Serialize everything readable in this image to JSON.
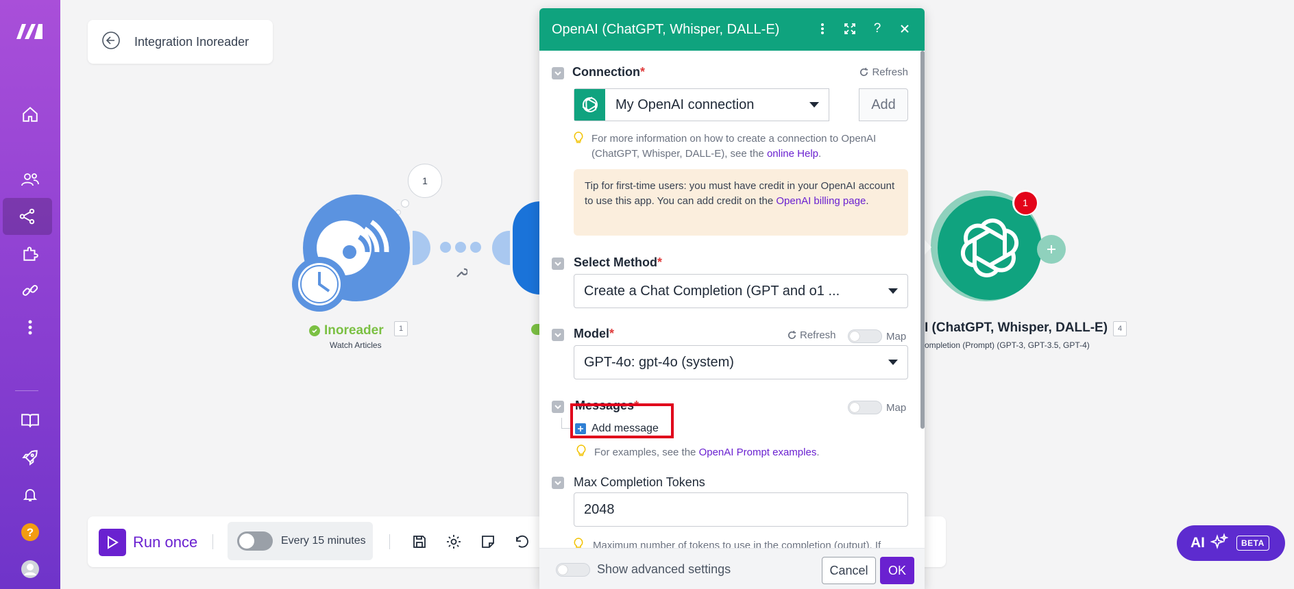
{
  "breadcrumb": {
    "title": "Integration Inoreader"
  },
  "canvas": {
    "module1": {
      "title": "Inoreader",
      "subtitle": "Watch Articles",
      "index": "1",
      "bubble": "1"
    },
    "module4": {
      "title": "I (ChatGPT, Whisper, DALL-E)",
      "subtitle": "ompletion (Prompt) (GPT-3, GPT-3.5, GPT-4)",
      "index": "4",
      "badge": "1"
    }
  },
  "toolbar": {
    "run_label": "Run once",
    "schedule_label": "Every 15 minutes"
  },
  "ai_button": {
    "label": "AI",
    "badge": "BETA"
  },
  "modal": {
    "title": "OpenAI (ChatGPT, Whisper, DALL-E)",
    "connection": {
      "label": "Connection",
      "required": "*",
      "refresh": "Refresh",
      "value": "My OpenAI connection",
      "add": "Add",
      "hint_prefix": "For more information on how to create a connection to OpenAI (ChatGPT, Whisper, DALL-E), see the ",
      "hint_link": "online Help",
      "hint_suffix": "."
    },
    "tip": {
      "prefix": "Tip for first-time users: you must have credit in your OpenAI account to use this app. You can add credit on the ",
      "link": "OpenAI billing page",
      "suffix": "."
    },
    "method": {
      "label": "Select Method",
      "required": "*",
      "value": "Create a Chat Completion (GPT and o1 ..."
    },
    "model": {
      "label": "Model",
      "required": "*",
      "refresh": "Refresh",
      "map": "Map",
      "value": "GPT-4o: gpt-4o (system)"
    },
    "messages": {
      "label": "Messages",
      "required": "*",
      "map": "Map",
      "add": "Add message",
      "hint_prefix": "For examples, see the ",
      "hint_link": "OpenAI Prompt examples",
      "hint_suffix": "."
    },
    "max_tokens": {
      "label": "Max Completion Tokens",
      "value": "2048",
      "hint": "Maximum number of tokens to use in the completion (output). If"
    },
    "footer": {
      "advanced": "Show advanced settings",
      "cancel": "Cancel",
      "ok": "OK"
    }
  },
  "colors": {
    "brand": "#6a21d0",
    "openai_green": "#0fa37e",
    "inoreader_blue": "#5b93e0",
    "highlight": "#e0001b"
  }
}
